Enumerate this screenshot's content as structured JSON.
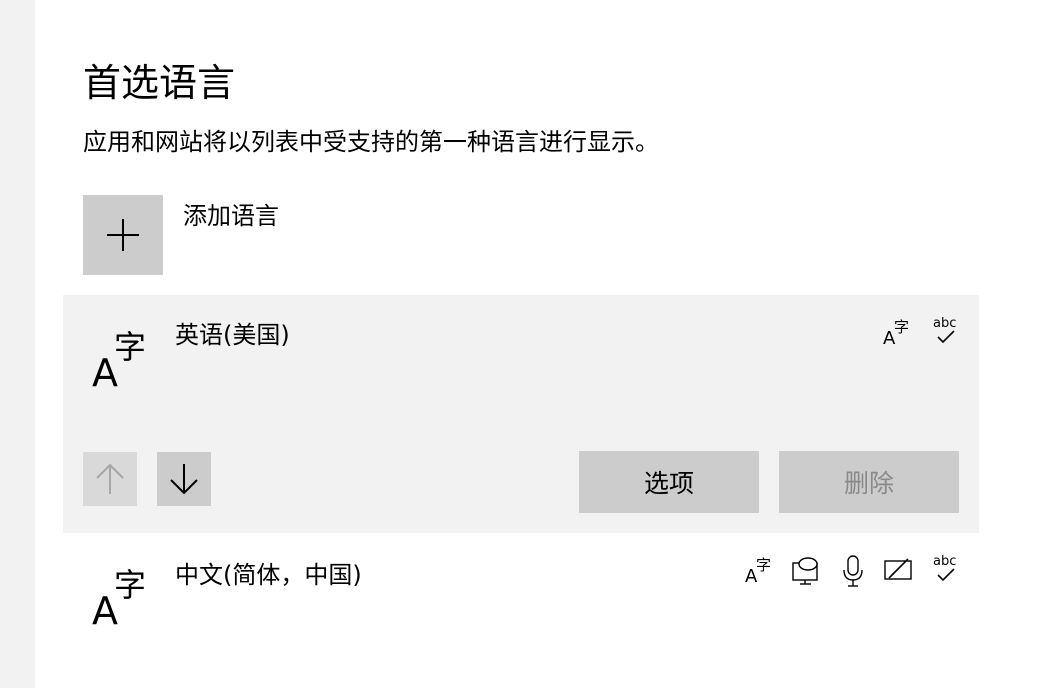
{
  "page": {
    "title": "首选语言",
    "description": "应用和网站将以列表中受支持的第一种语言进行显示。"
  },
  "add_language": {
    "label": "添加语言",
    "icon": "plus-icon"
  },
  "languages": [
    {
      "name": "英语(美国)",
      "selected": true,
      "features": [
        "display-language-icon",
        "spell-check-icon"
      ],
      "move_up_enabled": false,
      "move_down_enabled": true,
      "options_label": "选项",
      "remove_label": "删除",
      "remove_enabled": false
    },
    {
      "name": "中文(简体，中国)",
      "selected": false,
      "features": [
        "display-language-icon",
        "speech-bubble-icon",
        "microphone-icon",
        "handwriting-icon",
        "spell-check-icon"
      ]
    }
  ],
  "colors": {
    "selected_row_bg": "#f2f2f2",
    "button_bg": "#cccccc",
    "disabled_text": "#8a8a8a"
  }
}
